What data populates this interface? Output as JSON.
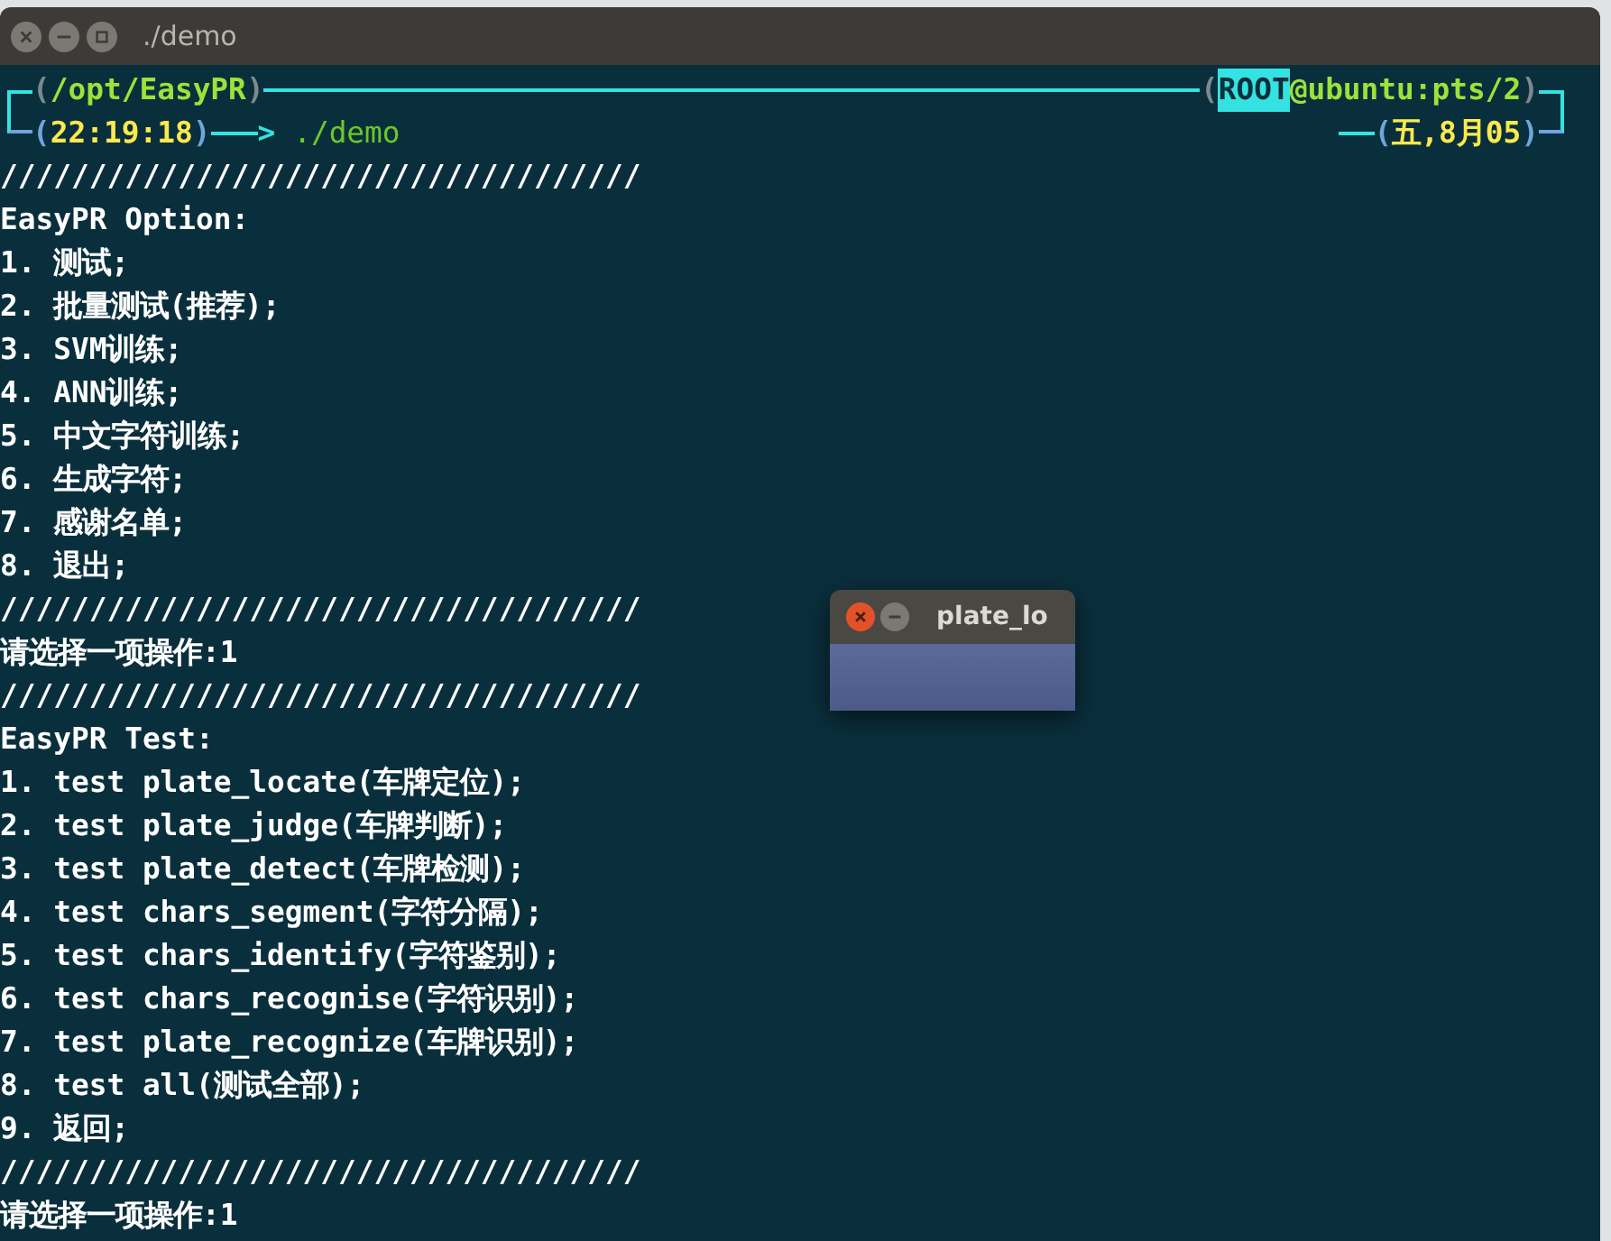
{
  "window": {
    "title": "./demo"
  },
  "prompt": {
    "top_left": [
      {
        "text": "(",
        "kind": "paren"
      },
      {
        "text": "/opt/EasyPR",
        "kind": "path"
      },
      {
        "text": ")",
        "kind": "paren"
      }
    ],
    "top_right": [
      {
        "text": "(",
        "kind": "paren"
      },
      {
        "text": "ROOT",
        "kind": "user"
      },
      {
        "text": "@ubuntu:pts/2",
        "kind": "path"
      },
      {
        "text": ")",
        "kind": "paren"
      }
    ],
    "bottom_left": [
      {
        "text": "(",
        "kind": "bracket"
      },
      {
        "text": "22:19:18",
        "kind": "time"
      },
      {
        "text": ")",
        "kind": "bracket"
      }
    ],
    "arrow": ">",
    "command": "./demo",
    "bottom_right": [
      {
        "text": "(",
        "kind": "bracket"
      },
      {
        "text": "五,8月05",
        "kind": "time"
      },
      {
        "text": ")",
        "kind": "bracket"
      }
    ]
  },
  "output_lines": [
    "////////////////////////////////////",
    "EasyPR Option:",
    "1. 测试;",
    "2. 批量测试(推荐);",
    "3. SVM训练;",
    "4. ANN训练;",
    "5. 中文字符训练;",
    "6. 生成字符;",
    "7. 感谢名单;",
    "8. 退出;",
    "////////////////////////////////////",
    "请选择一项操作:1",
    "////////////////////////////////////",
    "EasyPR Test:",
    "1. test plate_locate(车牌定位);",
    "2. test plate_judge(车牌判断);",
    "3. test plate_detect(车牌检测);",
    "4. test chars_segment(字符分隔);",
    "5. test chars_identify(字符鉴别);",
    "6. test chars_recognise(字符识别);",
    "7. test plate_recognize(车牌识别);",
    "8. test all(测试全部);",
    "9. 返回;",
    "////////////////////////////////////",
    "请选择一项操作:1"
  ],
  "popup": {
    "title": "plate_lo"
  }
}
